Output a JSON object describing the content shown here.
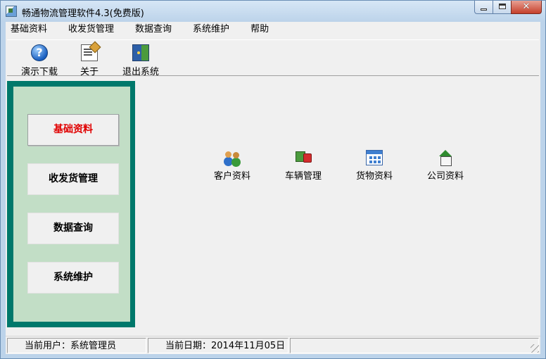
{
  "window": {
    "title": "畅通物流管理软件4.3(免费版)",
    "close_label": "✕"
  },
  "menubar": {
    "items": [
      "基础资料",
      "收发货管理",
      "数据查询",
      "系统维护",
      "帮助"
    ]
  },
  "toolbar": {
    "tools": [
      {
        "label": "演示下载",
        "icon": "help-icon"
      },
      {
        "label": "关于",
        "icon": "about-icon"
      },
      {
        "label": "退出系统",
        "icon": "exit-door-icon"
      }
    ]
  },
  "leftpanel": {
    "items": [
      {
        "label": "基础资料",
        "active": true
      },
      {
        "label": "收发货管理",
        "active": false
      },
      {
        "label": "数据查询",
        "active": false
      },
      {
        "label": "系统维护",
        "active": false
      }
    ]
  },
  "main": {
    "functions": [
      {
        "label": "客户资料",
        "icon": "customers-icon"
      },
      {
        "label": "车辆管理",
        "icon": "truck-icon"
      },
      {
        "label": "货物资料",
        "icon": "goods-icon"
      },
      {
        "label": "公司资料",
        "icon": "company-house-icon"
      }
    ]
  },
  "status": {
    "user": "当前用户：系统管理员",
    "date": "当前日期：2014年11月05日"
  },
  "colors": {
    "panel_border": "#00786b",
    "panel_fill": "#c2dec6",
    "active_text": "#e00000"
  }
}
